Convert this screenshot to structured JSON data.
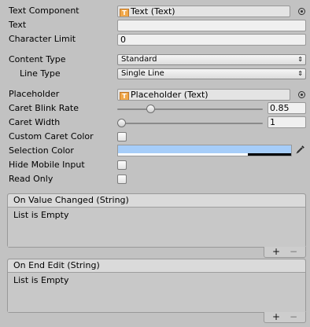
{
  "rows": {
    "text_component": {
      "label": "Text Component",
      "value": "Text (Text)",
      "icon": "text-component-icon"
    },
    "text": {
      "label": "Text",
      "value": ""
    },
    "character_limit": {
      "label": "Character Limit",
      "value": "0"
    },
    "content_type": {
      "label": "Content Type",
      "value": "Standard"
    },
    "line_type": {
      "label": "Line Type",
      "value": "Single Line"
    },
    "placeholder": {
      "label": "Placeholder",
      "value": "Placeholder (Text)",
      "icon": "text-component-icon"
    },
    "caret_blink_rate": {
      "label": "Caret Blink Rate",
      "value": "0.85",
      "slider_fraction": 0.21
    },
    "caret_width": {
      "label": "Caret Width",
      "value": "1",
      "slider_fraction": 0.0
    },
    "custom_caret_color": {
      "label": "Custom Caret Color",
      "checked": false
    },
    "selection_color": {
      "label": "Selection Color",
      "color": "#a6cdf9",
      "alpha_fraction": 0.25
    },
    "hide_mobile_input": {
      "label": "Hide Mobile Input",
      "checked": false
    },
    "read_only": {
      "label": "Read Only",
      "checked": false
    }
  },
  "events": {
    "on_value_changed": {
      "title": "On Value Changed (String)",
      "body": "List is Empty",
      "add": "+",
      "remove": "−"
    },
    "on_end_edit": {
      "title": "On End Edit (String)",
      "body": "List is Empty",
      "add": "+",
      "remove": "−"
    }
  },
  "colors": {
    "panel": "#c2c2c2",
    "selection": "#a6cdf9",
    "icon": "#f1a84a"
  }
}
